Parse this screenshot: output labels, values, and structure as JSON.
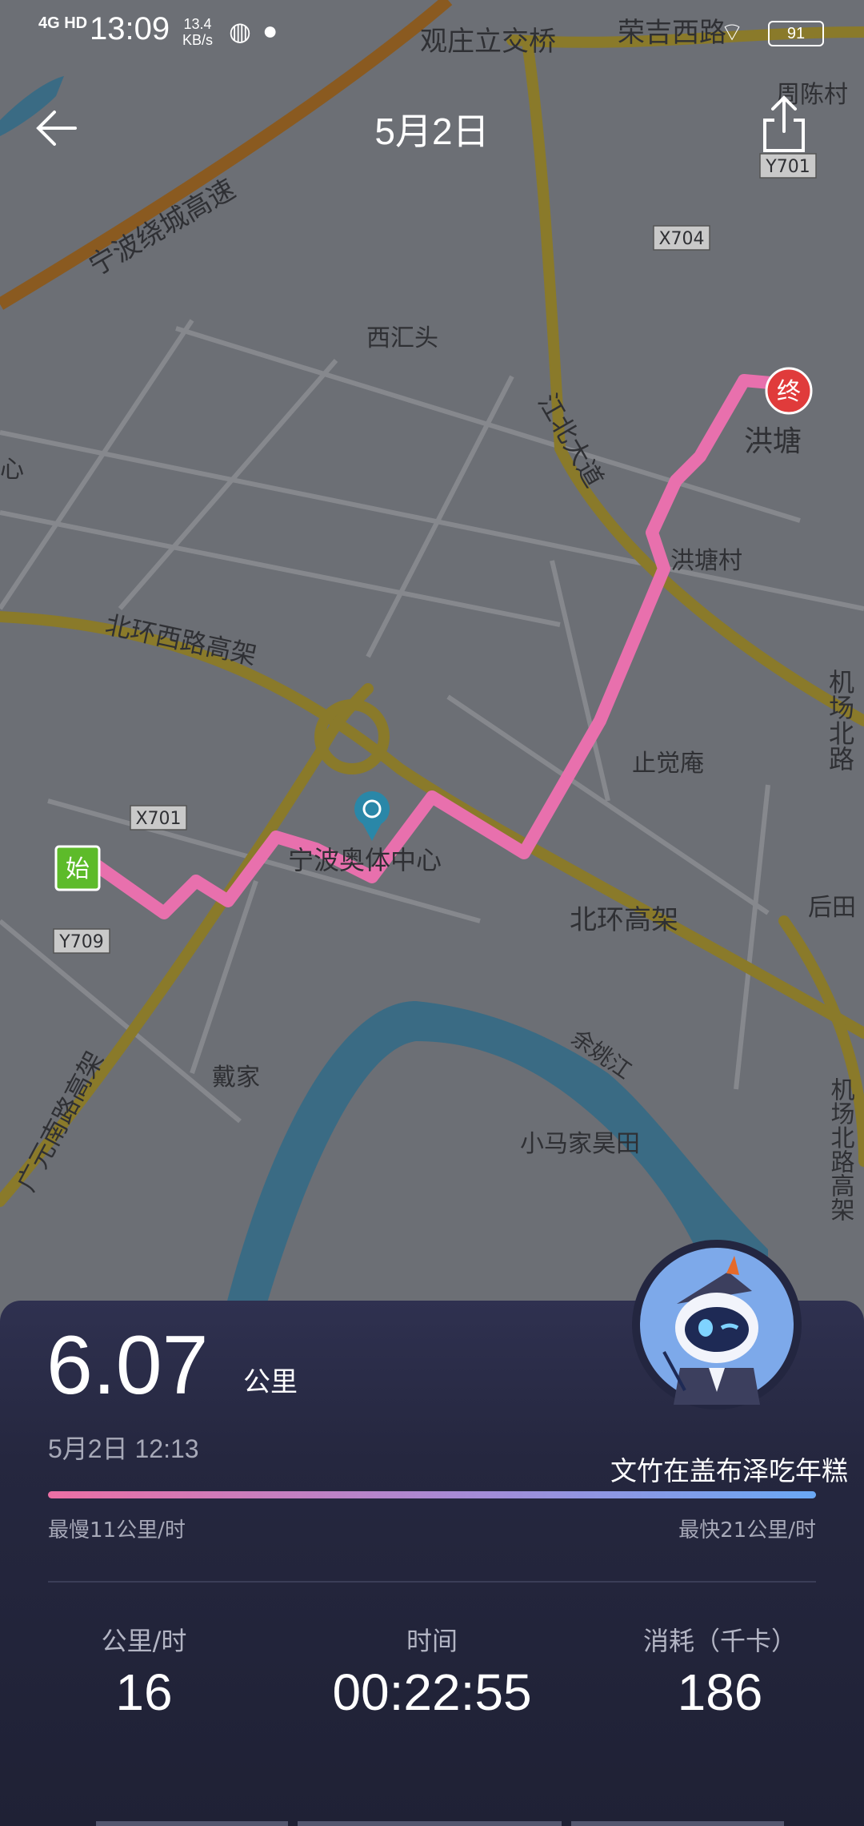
{
  "status_bar": {
    "network": "4G HD",
    "time": "13:09",
    "speed_value": "13.4",
    "speed_unit": "KB/s",
    "battery": "91",
    "status_icons": [
      "data-saver-icon",
      "planet-icon",
      "wifi-icon"
    ]
  },
  "header": {
    "title": "5月2日",
    "back_icon": "arrow-left-icon",
    "share_icon": "share-icon"
  },
  "map": {
    "labels": {
      "guanzhuang_bridge": "观庄立交桥",
      "rongji_west_road": "荣吉西路",
      "zhouchencun": "周陈村",
      "ningbo_ring_expressway": "宁波绕城高速",
      "xihuitou": "西汇头",
      "jiangbei_avenue": "江北大道",
      "hongtang": "洪塘",
      "hongtang_village": "洪塘村",
      "xin": "心",
      "north_ring_west_elevated": "北环西路高架",
      "airport_north_road_1": "机场北路",
      "zhijuean": "止觉庵",
      "olympic_center": "宁波奥体中心",
      "north_ring_elevated": "北环高架",
      "houtian": "后田",
      "guangyuan_elevated": "广元南路高架",
      "daijia": "戴家",
      "yuyao_river": "余姚江",
      "xiaomajia": "小马家昊田",
      "airport_north_road_2": "机场北路高架"
    },
    "road_codes": [
      "Y701",
      "X704",
      "X701",
      "Y709"
    ],
    "start_marker": "始",
    "end_marker": "终",
    "route_color_start": "#e870ad",
    "route_color_end": "#e96aa6"
  },
  "summary": {
    "distance": "6.07",
    "distance_unit": "公里",
    "datetime": "5月2日 12:13",
    "slogan": "文竹在盖布泽吃年糕",
    "slowest": "最慢11公里/时",
    "fastest": "最快21公里/时",
    "speed_gradient": [
      "#ec6fa4",
      "#a58bd6",
      "#6aa8f5"
    ],
    "stats": [
      {
        "label": "公里/时",
        "value": "16"
      },
      {
        "label": "时间",
        "value": "00:22:55"
      },
      {
        "label": "消耗（千卡）",
        "value": "186"
      }
    ]
  },
  "mascot": "robot-mascot-avatar"
}
